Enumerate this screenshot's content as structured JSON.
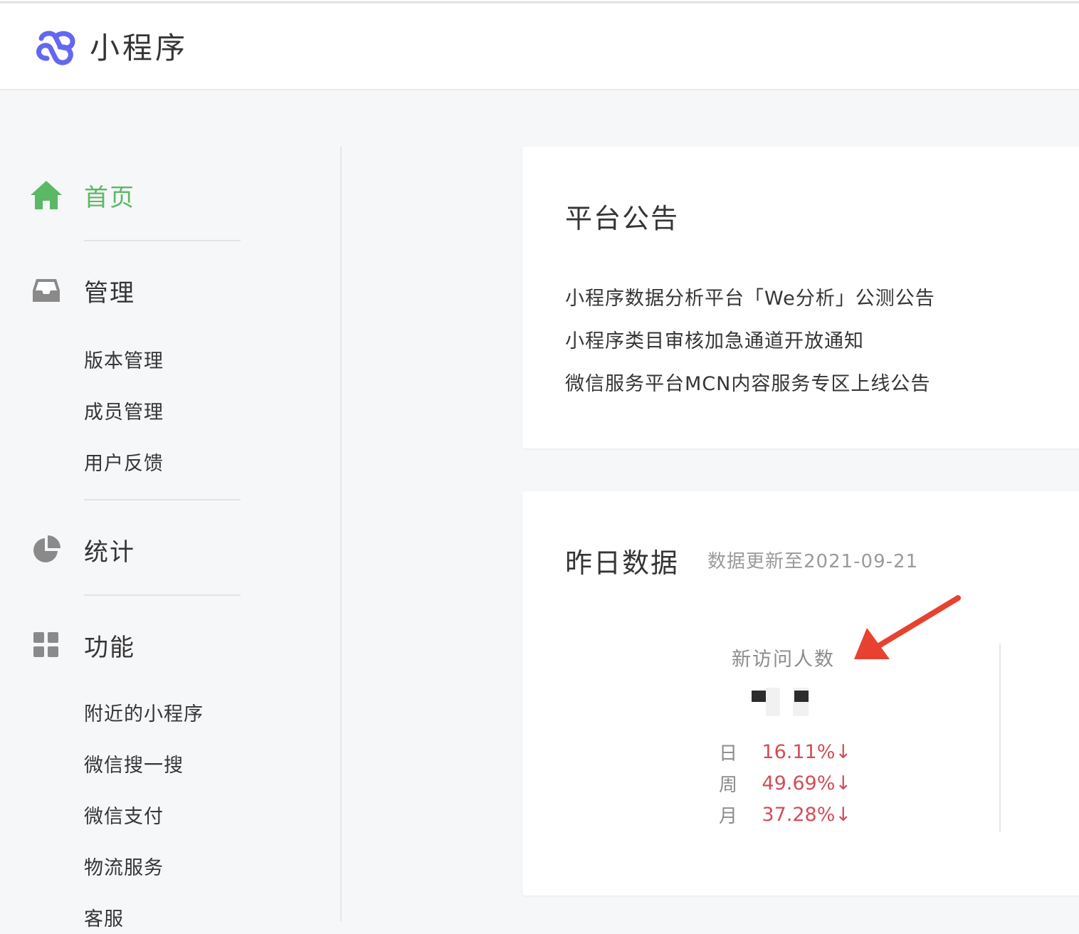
{
  "header": {
    "app_title": "小程序"
  },
  "sidebar": {
    "home": {
      "label": "首页",
      "icon": "home-icon",
      "active": true,
      "color": "#5bb865"
    },
    "manage": {
      "label": "管理",
      "icon": "inbox-icon",
      "items": [
        "版本管理",
        "成员管理",
        "用户反馈"
      ]
    },
    "stats": {
      "label": "统计",
      "icon": "pie-chart-icon"
    },
    "features": {
      "label": "功能",
      "icon": "grid-icon",
      "items": [
        "附近的小程序",
        "微信搜一搜",
        "微信支付",
        "物流服务",
        "客服"
      ]
    }
  },
  "notice": {
    "title": "平台公告",
    "items": [
      "小程序数据分析平台「We分析」公测公告",
      "小程序类目审核加急通道开放通知",
      "微信服务平台MCN内容服务专区上线公告"
    ]
  },
  "yesterday": {
    "title": "昨日数据",
    "updated": "数据更新至2021-09-21",
    "metric": {
      "label": "新访问人数",
      "value_redacted": true,
      "comparisons": [
        {
          "label": "日",
          "value": "16.11%↓"
        },
        {
          "label": "周",
          "value": "49.69%↓"
        },
        {
          "label": "月",
          "value": "37.28%↓"
        }
      ]
    }
  },
  "annotation": {
    "type": "arrow",
    "color": "#e8412f"
  }
}
